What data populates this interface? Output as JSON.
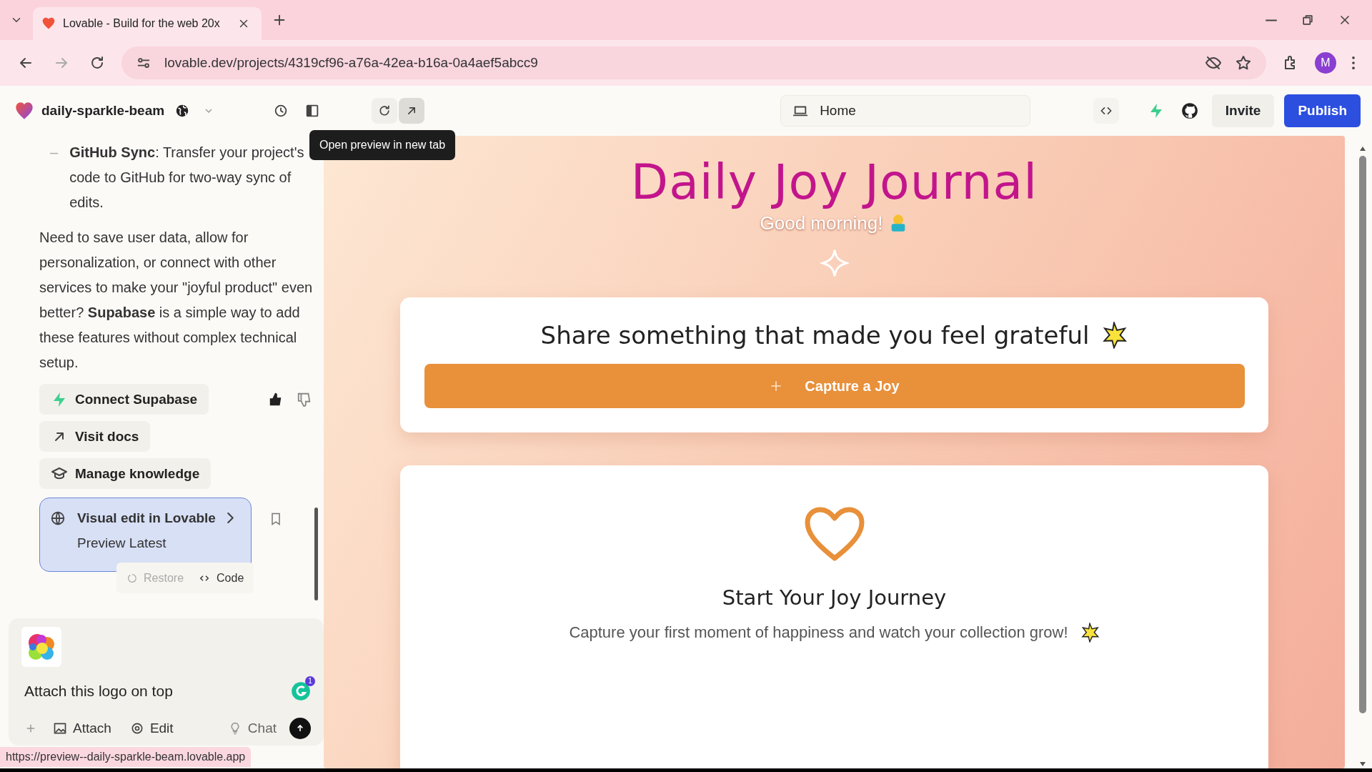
{
  "browser": {
    "tab_title": "Lovable - Build for the web 20x",
    "url": "lovable.dev/projects/4319cf96-a76a-42ea-b16a-0a4aef5abcc9",
    "profile_initial": "M"
  },
  "header": {
    "project": "daily-sparkle-beam",
    "route": "Home",
    "invite": "Invite",
    "publish": "Publish",
    "tooltip": "Open preview in new tab"
  },
  "chat": {
    "list_items": [
      {
        "bullet": "–",
        "text": "**GitHub Sync**: Transfer your project's code to GitHub for two-way sync of edits."
      }
    ],
    "paragraph": "Need to save user data, allow for personalization, or connect with other services to make your \"joyful product\" even better? **Supabase** is a simple way to add these features without complex technical setup.",
    "actions": [
      {
        "kind": "supabase",
        "label": "Connect Supabase"
      },
      {
        "kind": "docs",
        "label": "Visit docs"
      },
      {
        "kind": "knowledge",
        "label": "Manage knowledge"
      }
    ],
    "feedback": {
      "liked": true,
      "disliked": false
    },
    "version_card": {
      "title": "Visual edit in Lovable",
      "subtitle": "Preview Latest",
      "buttons": [
        {
          "kind": "restore",
          "label": "Restore",
          "disabled": true
        },
        {
          "kind": "code",
          "label": "Code",
          "disabled": false
        }
      ]
    }
  },
  "composer": {
    "value": "Attach this logo on top",
    "grammar_badge": "1",
    "tools": [
      {
        "kind": "attach",
        "label": "Attach"
      },
      {
        "kind": "edit",
        "label": "Edit"
      },
      {
        "kind": "chat",
        "label": "Chat"
      }
    ]
  },
  "status_link": "https://preview--daily-sparkle-beam.lovable.app",
  "preview": {
    "title": "Daily Joy Journal",
    "greeting": "Good morning!",
    "prompt": "Share something that made you feel grateful",
    "capture_button": "Capture a Joy",
    "empty_title": "Start Your Joy Journey",
    "empty_text": "Capture your first moment of happiness and watch your collection grow!"
  }
}
